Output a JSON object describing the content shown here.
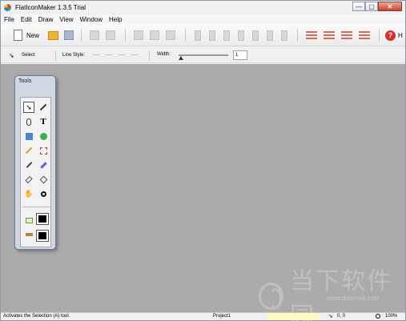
{
  "window": {
    "title": "FlatIconMaker 1.3.5 Trial",
    "buttons": {
      "minimize": "—",
      "maximize": "▢",
      "close": "✕"
    }
  },
  "menu": [
    "File",
    "Edit",
    "Draw",
    "View",
    "Window",
    "Help"
  ],
  "toolbar": {
    "new_label": "New",
    "help_label": "H",
    "icons": [
      "new-document-icon",
      "open-folder-icon",
      "save-icon",
      "copy-icon",
      "paste-icon",
      "cut-icon",
      "redo-icon",
      "add-icon",
      "align-left-icon",
      "align-center-icon",
      "align-right-icon",
      "align-top-icon",
      "align-middle-icon",
      "align-bottom-icon",
      "distribute-icon",
      "distribute-vertical-icon",
      "layer-up-icon",
      "layer-down-icon",
      "layer-top-icon",
      "layer-bottom-icon",
      "help-icon"
    ]
  },
  "options": {
    "select_label": "Select",
    "line_style_label": "Line Style:",
    "width_label": "Width:",
    "width_value": "1",
    "width_slider": 0.0
  },
  "tools_panel": {
    "title": "Tools",
    "tools": [
      "selection-tool",
      "pen-tool",
      "node-tool",
      "text-tool",
      "rectangle-tool",
      "ellipse-tool",
      "line-tool",
      "transform-tool",
      "eyedropper-tool",
      "brush-tool",
      "eraser-tool",
      "fill-tool",
      "hand-tool",
      "zoom-tool"
    ],
    "text_tool_glyph": "T",
    "colors": {
      "fill": "#000000",
      "stroke": "#000000"
    }
  },
  "watermark": {
    "text": "当下软件园",
    "url": "www.downxia.com"
  },
  "status": {
    "message": "Activates the Selection (A) tool.",
    "project": "Project1",
    "coords": "0, 0",
    "zoom": "100%"
  },
  "colors": {
    "canvas": "#ababab",
    "accent": "#d9685d",
    "tools_panel": "#cfd8e3"
  }
}
